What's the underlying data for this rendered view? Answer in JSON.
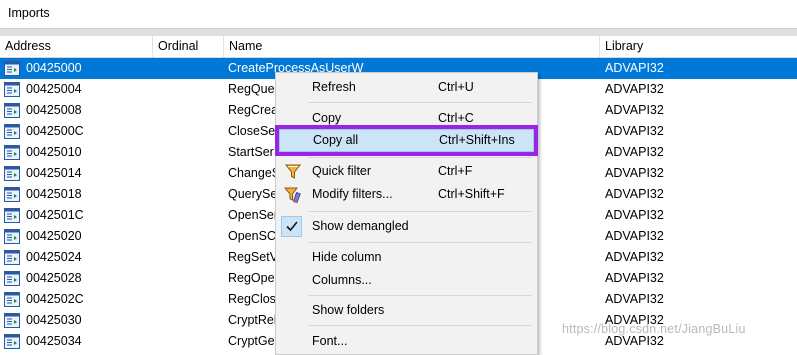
{
  "window": {
    "title": "Imports"
  },
  "columns": [
    "Address",
    "Ordinal",
    "Name",
    "Library"
  ],
  "rows": [
    {
      "address": "00425000",
      "ordinal": "",
      "name": "CreateProcessAsUserW",
      "library": "ADVAPI32",
      "selected": true
    },
    {
      "address": "00425004",
      "ordinal": "",
      "name": "RegQue",
      "library": "ADVAPI32"
    },
    {
      "address": "00425008",
      "ordinal": "",
      "name": "RegCrea",
      "library": "ADVAPI32"
    },
    {
      "address": "0042500C",
      "ordinal": "",
      "name": "CloseSe",
      "library": "ADVAPI32"
    },
    {
      "address": "00425010",
      "ordinal": "",
      "name": "StartSer",
      "library": "ADVAPI32"
    },
    {
      "address": "00425014",
      "ordinal": "",
      "name": "ChangeS",
      "library": "ADVAPI32"
    },
    {
      "address": "00425018",
      "ordinal": "",
      "name": "QuerySe",
      "library": "ADVAPI32"
    },
    {
      "address": "0042501C",
      "ordinal": "",
      "name": "OpenSer",
      "library": "ADVAPI32"
    },
    {
      "address": "00425020",
      "ordinal": "",
      "name": "OpenSC",
      "library": "ADVAPI32"
    },
    {
      "address": "00425024",
      "ordinal": "",
      "name": "RegSetV",
      "library": "ADVAPI32"
    },
    {
      "address": "00425028",
      "ordinal": "",
      "name": "RegOpe",
      "library": "ADVAPI32"
    },
    {
      "address": "0042502C",
      "ordinal": "",
      "name": "RegClos",
      "library": "ADVAPI32"
    },
    {
      "address": "00425030",
      "ordinal": "",
      "name": "CryptRel",
      "library": "ADVAPI32"
    },
    {
      "address": "00425034",
      "ordinal": "",
      "name": "CryptGe",
      "library": "ADVAPI32"
    }
  ],
  "context_menu": {
    "refresh": {
      "label": "Refresh",
      "shortcut": "Ctrl+U"
    },
    "copy": {
      "label": "Copy",
      "shortcut": "Ctrl+C"
    },
    "copy_all": {
      "label": "Copy all",
      "shortcut": "Ctrl+Shift+Ins"
    },
    "quick_filter": {
      "label": "Quick filter",
      "shortcut": "Ctrl+F",
      "icon": "funnel-icon"
    },
    "modify_filters": {
      "label": "Modify filters...",
      "shortcut": "Ctrl+Shift+F",
      "icon": "funnel-edit-icon"
    },
    "show_demangled": {
      "label": "Show demangled",
      "checked": true
    },
    "hide_column": {
      "label": "Hide column"
    },
    "columns": {
      "label": "Columns..."
    },
    "show_folders": {
      "label": "Show folders"
    },
    "font": {
      "label": "Font..."
    }
  },
  "colors": {
    "selection": "#0078d7",
    "menu_highlight": "#cce4f7",
    "annotation_outline": "#9b24e6"
  },
  "watermark": "https://blog.csdn.net/JiangBuLiu"
}
